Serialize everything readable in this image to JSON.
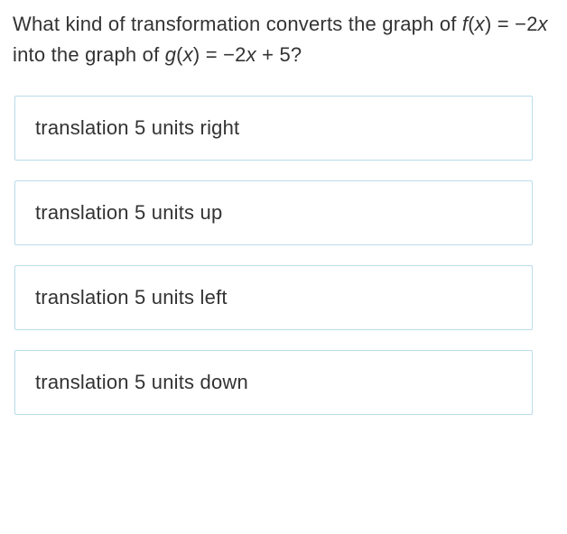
{
  "question": {
    "pre": "What kind of transformation converts the graph of ",
    "f_name": "f",
    "f_of": "(",
    "f_var": "x",
    "f_close": ")",
    "eq1": " = −2",
    "x1": "x",
    "mid": " into the graph of ",
    "g_name": "g",
    "g_of": "(",
    "g_var": "x",
    "g_close": ")",
    "eq2": " = −2",
    "x2": "x",
    "tail": " + 5?"
  },
  "options": [
    {
      "label": "translation 5 units right"
    },
    {
      "label": "translation 5 units up"
    },
    {
      "label": "translation 5 units left"
    },
    {
      "label": "translation 5 units down"
    }
  ]
}
